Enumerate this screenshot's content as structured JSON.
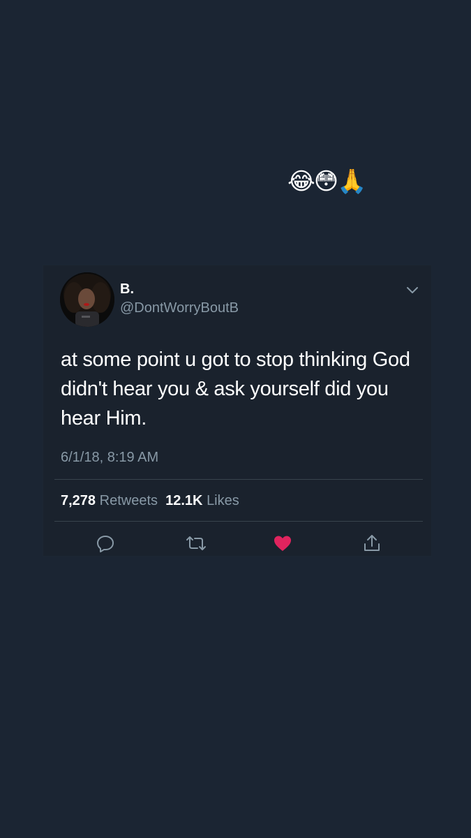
{
  "caption": {
    "emojis": "😂😳🙏"
  },
  "tweet": {
    "display_name": "B.",
    "handle": "@DontWorryBoutB",
    "text": "at some point u got to stop thinking God didn't hear you & ask yourself did you hear Him.",
    "timestamp": "6/1/18, 8:19 AM",
    "retweet_count": "7,278",
    "retweet_label": "Retweets",
    "like_count": "12.1K",
    "like_label": "Likes"
  },
  "actions": [
    {
      "icon": "reply-icon"
    },
    {
      "icon": "retweet-icon"
    },
    {
      "icon": "heart-icon",
      "active": true
    },
    {
      "icon": "share-icon"
    }
  ],
  "colors": {
    "background": "#1b2533",
    "card": "#1a222d",
    "secondary_text": "#8899a6",
    "like_active": "#e0245e"
  }
}
